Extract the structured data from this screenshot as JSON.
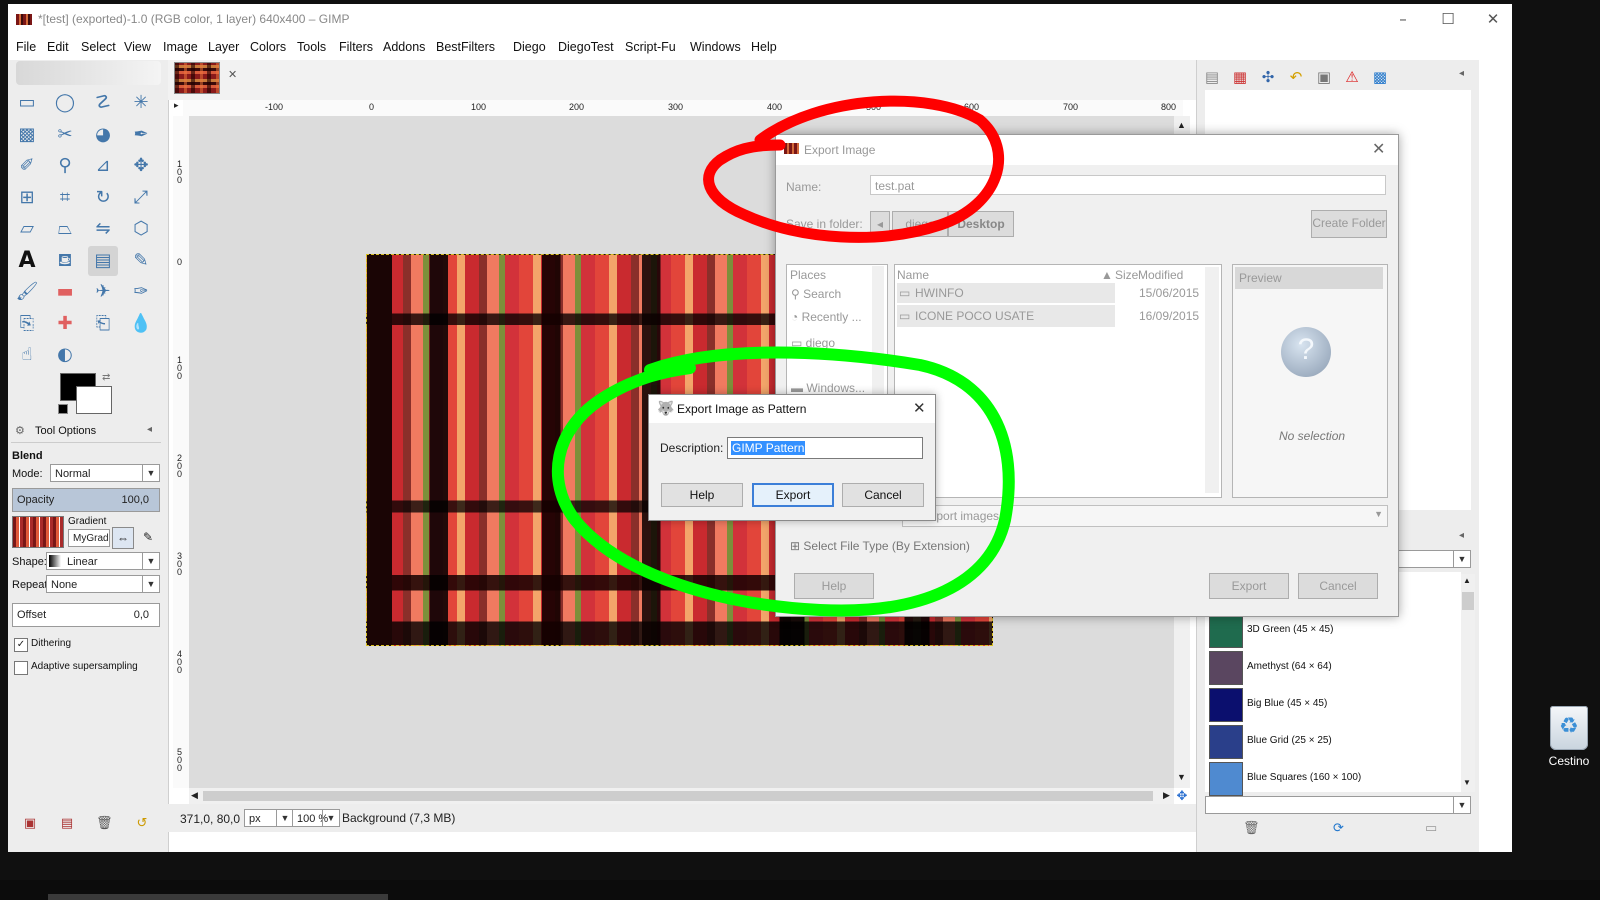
{
  "window": {
    "title": "*[test] (exported)-1.0 (RGB color, 1 layer) 640x400 – GIMP"
  },
  "menu": [
    "File",
    "Edit",
    "Select",
    "View",
    "Image",
    "Layer",
    "Colors",
    "Tools",
    "Filters",
    "Addons",
    "BestFilters",
    "Diego",
    "DiegoTest",
    "Script-Fu",
    "Windows",
    "Help"
  ],
  "toolbox": {
    "tools": [
      "rect-select",
      "ellipse-select",
      "free-select",
      "fuzzy-select",
      "select-by-color",
      "scissors",
      "foreground-select",
      "paths",
      "color-picker",
      "zoom",
      "measure",
      "move",
      "align",
      "crop",
      "rotate",
      "scale",
      "shear",
      "perspective",
      "flip",
      "cage",
      "text",
      "bucket-fill",
      "blend",
      "pencil",
      "paintbrush",
      "eraser",
      "airbrush",
      "ink",
      "clone",
      "heal",
      "perspective-clone",
      "blur",
      "smudge",
      "dodge-burn"
    ],
    "tab_label": "Tool Options",
    "tool_name": "Blend",
    "mode_label": "Mode:",
    "mode_value": "Normal",
    "opacity_label": "Opacity",
    "opacity_value": "100,0",
    "gradient_label": "Gradient",
    "gradient_value": "MyGrad",
    "shape_label": "Shape:",
    "shape_value": "Linear",
    "repeat_label": "Repeat:",
    "repeat_value": "None",
    "offset_label": "Offset",
    "offset_value": "0,0",
    "dithering_label": "Dithering",
    "dithering_checked": true,
    "adaptive_label": "Adaptive supersampling",
    "adaptive_checked": false
  },
  "ruler": {
    "top": [
      "-100",
      "0",
      "100",
      "200",
      "300",
      "400",
      "500",
      "600",
      "700",
      "800"
    ],
    "left": [
      "1\n0\n0",
      "0",
      "1\n0\n0",
      "2\n0\n0",
      "3\n0\n0",
      "4\n0\n0",
      "5\n0\n0"
    ]
  },
  "status": {
    "coords": "371,0, 80,0",
    "unit": "px",
    "zoom": "100 %",
    "layer": "Background (7,3 MB)"
  },
  "patterns": [
    {
      "name": "3D Green (45 × 45)",
      "color": "#1f6b4e"
    },
    {
      "name": "Amethyst (64 × 64)",
      "color": "#5a4660"
    },
    {
      "name": "Big Blue (45 × 45)",
      "color": "#0b0f6e"
    },
    {
      "name": "Blue Grid (25 × 25)",
      "color": "#2a3f8a"
    },
    {
      "name": "Blue Squares (160 × 100)",
      "color": "#4f8ad0"
    }
  ],
  "export_dialog": {
    "title": "Export Image",
    "name_label": "Name:",
    "name_value": "test.pat",
    "folder_label": "Save in folder:",
    "breadcrumb": [
      "diego",
      "Desktop"
    ],
    "create_folder": "Create Folder",
    "places_header": "Places",
    "places": [
      "Search",
      "Recently ...",
      "diego",
      "Windows..."
    ],
    "col_name": "Name",
    "col_size": "Size",
    "col_modified": "Modified",
    "files": [
      {
        "name": "HWINFO",
        "modified": "15/06/2015"
      },
      {
        "name": "ICONE POCO USATE",
        "modified": "16/09/2015"
      }
    ],
    "preview_label": "Preview",
    "no_selection": "No selection",
    "filter": "All export images",
    "filetype": "Select File Type (By Extension)",
    "help": "Help",
    "export": "Export",
    "cancel": "Cancel"
  },
  "pattern_dialog": {
    "title": "Export Image as Pattern",
    "desc_label": "Description:",
    "desc_value": "GIMP Pattern",
    "help": "Help",
    "export": "Export",
    "cancel": "Cancel"
  },
  "desktop": {
    "recycle_label": "Cestino"
  },
  "annotation_colors": {
    "red": "#ff0000",
    "green": "#00ff00"
  }
}
